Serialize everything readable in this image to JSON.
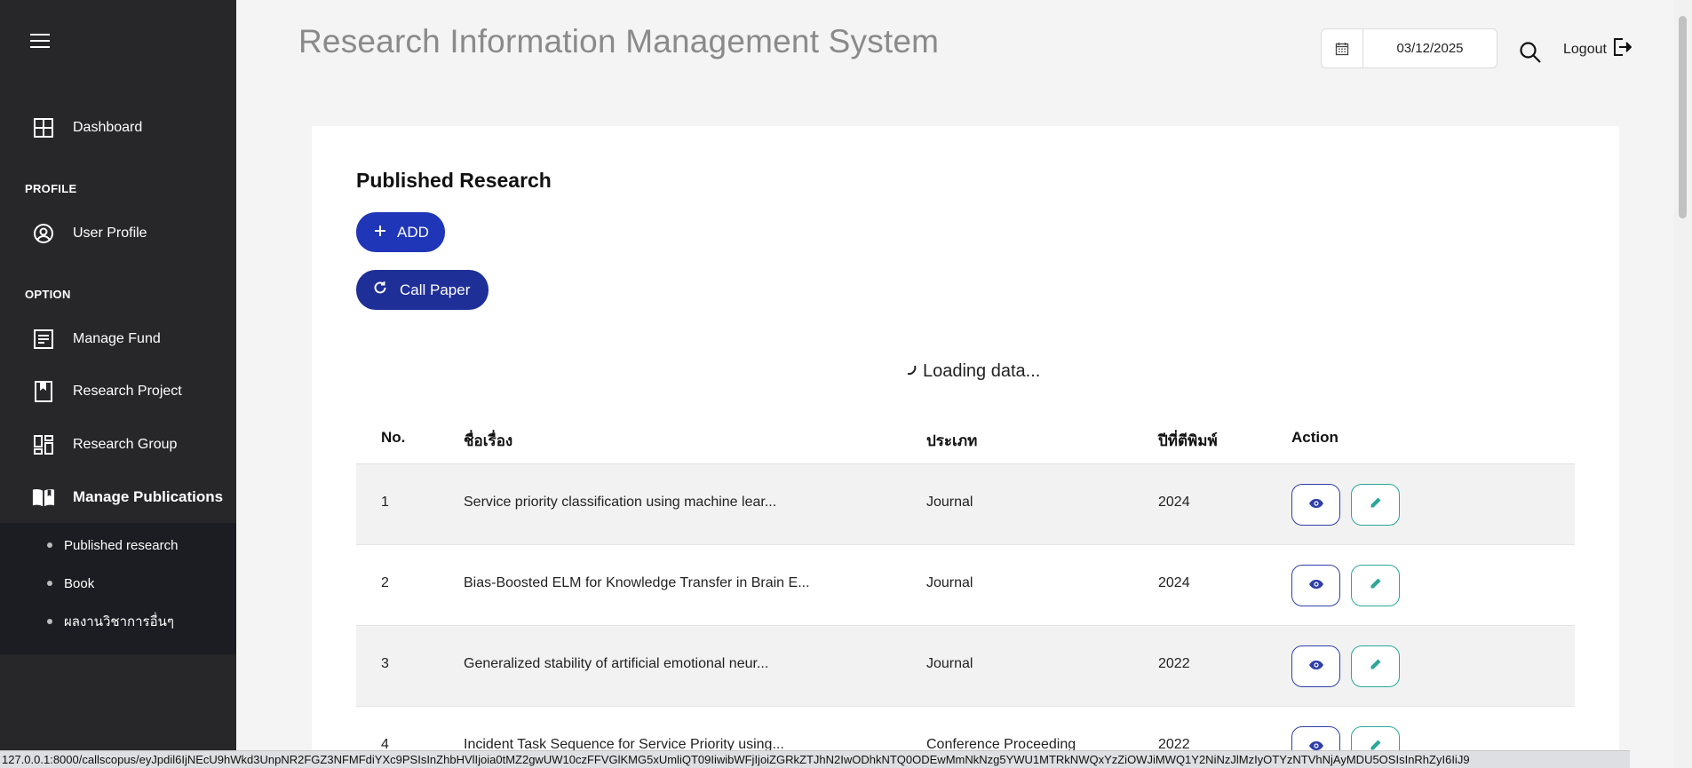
{
  "app": {
    "title": "Research Information Management System"
  },
  "header": {
    "date_value": "03/12/2025",
    "logout_label": "Logout"
  },
  "sidebar": {
    "dashboard": "Dashboard",
    "profile_section": "PROFILE",
    "user_profile": "User Profile",
    "option_section": "OPTION",
    "manage_fund": "Manage Fund",
    "research_project": "Research Project",
    "research_group": "Research Group",
    "manage_publications": "Manage Publications",
    "sub": [
      "Published research",
      "Book",
      "ผลงานวิชาการอื่นๆ"
    ]
  },
  "main": {
    "title": "Published Research",
    "add_label": "ADD",
    "call_paper_label": "Call Paper",
    "loading_text": "Loading data..."
  },
  "table": {
    "headers": [
      "No.",
      "ชื่อเรื่อง",
      "ประเภท",
      "ปีที่ตีพิมพ์",
      "Action"
    ],
    "rows": [
      {
        "no": "1",
        "title": "Service priority classification using machine lear...",
        "type": "Journal",
        "year": "2024"
      },
      {
        "no": "2",
        "title": "Bias-Boosted ELM for Knowledge Transfer in Brain E...",
        "type": "Journal",
        "year": "2024"
      },
      {
        "no": "3",
        "title": "Generalized stability of artificial emotional neur...",
        "type": "Journal",
        "year": "2022"
      },
      {
        "no": "4",
        "title": "Incident Task Sequence for Service Priority using...",
        "type": "Conference Proceeding",
        "year": "2022"
      }
    ]
  },
  "statusbar": {
    "url": "127.0.0.1:8000/callscopus/eyJpdil6IjNEcU9hWkd3UnpNR2FGZ3NFMFdiYXc9PSIsInZhbHVlIjoia0tMZ2gwUW10czFFVGlKMG5xUmliQT09IiwibWFjIjoiZGRkZTJhN2IwODhkNTQ0ODEwMmNkNzg5YWU1MTRkNWQxYzZiOWJiMWQ1Y2NiNzJlMzIyOTYzNTVhNjAyMDU5OSIsInRhZyI6IiJ9"
  },
  "colors": {
    "sidebar_bg": "#27272a",
    "submenu_bg": "#1c1d22",
    "primary": "#2036b8",
    "primary_dark": "#1f2f98",
    "view_icon": "#2f3fa8",
    "edit_icon": "#2ba69a"
  }
}
